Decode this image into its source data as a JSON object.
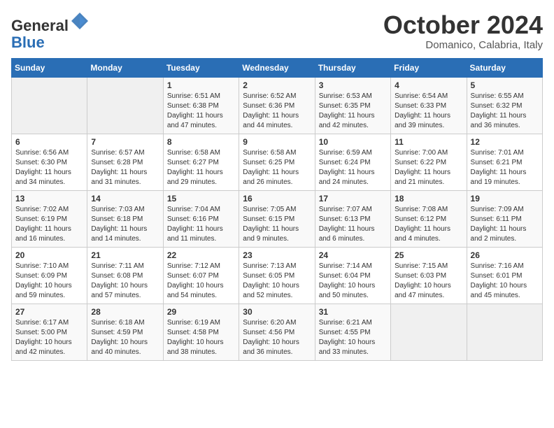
{
  "header": {
    "logo_line1": "General",
    "logo_line2": "Blue",
    "month": "October 2024",
    "location": "Domanico, Calabria, Italy"
  },
  "days_of_week": [
    "Sunday",
    "Monday",
    "Tuesday",
    "Wednesday",
    "Thursday",
    "Friday",
    "Saturday"
  ],
  "weeks": [
    [
      {
        "day": "",
        "info": ""
      },
      {
        "day": "",
        "info": ""
      },
      {
        "day": "1",
        "info": "Sunrise: 6:51 AM\nSunset: 6:38 PM\nDaylight: 11 hours\nand 47 minutes."
      },
      {
        "day": "2",
        "info": "Sunrise: 6:52 AM\nSunset: 6:36 PM\nDaylight: 11 hours\nand 44 minutes."
      },
      {
        "day": "3",
        "info": "Sunrise: 6:53 AM\nSunset: 6:35 PM\nDaylight: 11 hours\nand 42 minutes."
      },
      {
        "day": "4",
        "info": "Sunrise: 6:54 AM\nSunset: 6:33 PM\nDaylight: 11 hours\nand 39 minutes."
      },
      {
        "day": "5",
        "info": "Sunrise: 6:55 AM\nSunset: 6:32 PM\nDaylight: 11 hours\nand 36 minutes."
      }
    ],
    [
      {
        "day": "6",
        "info": "Sunrise: 6:56 AM\nSunset: 6:30 PM\nDaylight: 11 hours\nand 34 minutes."
      },
      {
        "day": "7",
        "info": "Sunrise: 6:57 AM\nSunset: 6:28 PM\nDaylight: 11 hours\nand 31 minutes."
      },
      {
        "day": "8",
        "info": "Sunrise: 6:58 AM\nSunset: 6:27 PM\nDaylight: 11 hours\nand 29 minutes."
      },
      {
        "day": "9",
        "info": "Sunrise: 6:58 AM\nSunset: 6:25 PM\nDaylight: 11 hours\nand 26 minutes."
      },
      {
        "day": "10",
        "info": "Sunrise: 6:59 AM\nSunset: 6:24 PM\nDaylight: 11 hours\nand 24 minutes."
      },
      {
        "day": "11",
        "info": "Sunrise: 7:00 AM\nSunset: 6:22 PM\nDaylight: 11 hours\nand 21 minutes."
      },
      {
        "day": "12",
        "info": "Sunrise: 7:01 AM\nSunset: 6:21 PM\nDaylight: 11 hours\nand 19 minutes."
      }
    ],
    [
      {
        "day": "13",
        "info": "Sunrise: 7:02 AM\nSunset: 6:19 PM\nDaylight: 11 hours\nand 16 minutes."
      },
      {
        "day": "14",
        "info": "Sunrise: 7:03 AM\nSunset: 6:18 PM\nDaylight: 11 hours\nand 14 minutes."
      },
      {
        "day": "15",
        "info": "Sunrise: 7:04 AM\nSunset: 6:16 PM\nDaylight: 11 hours\nand 11 minutes."
      },
      {
        "day": "16",
        "info": "Sunrise: 7:05 AM\nSunset: 6:15 PM\nDaylight: 11 hours\nand 9 minutes."
      },
      {
        "day": "17",
        "info": "Sunrise: 7:07 AM\nSunset: 6:13 PM\nDaylight: 11 hours\nand 6 minutes."
      },
      {
        "day": "18",
        "info": "Sunrise: 7:08 AM\nSunset: 6:12 PM\nDaylight: 11 hours\nand 4 minutes."
      },
      {
        "day": "19",
        "info": "Sunrise: 7:09 AM\nSunset: 6:11 PM\nDaylight: 11 hours\nand 2 minutes."
      }
    ],
    [
      {
        "day": "20",
        "info": "Sunrise: 7:10 AM\nSunset: 6:09 PM\nDaylight: 10 hours\nand 59 minutes."
      },
      {
        "day": "21",
        "info": "Sunrise: 7:11 AM\nSunset: 6:08 PM\nDaylight: 10 hours\nand 57 minutes."
      },
      {
        "day": "22",
        "info": "Sunrise: 7:12 AM\nSunset: 6:07 PM\nDaylight: 10 hours\nand 54 minutes."
      },
      {
        "day": "23",
        "info": "Sunrise: 7:13 AM\nSunset: 6:05 PM\nDaylight: 10 hours\nand 52 minutes."
      },
      {
        "day": "24",
        "info": "Sunrise: 7:14 AM\nSunset: 6:04 PM\nDaylight: 10 hours\nand 50 minutes."
      },
      {
        "day": "25",
        "info": "Sunrise: 7:15 AM\nSunset: 6:03 PM\nDaylight: 10 hours\nand 47 minutes."
      },
      {
        "day": "26",
        "info": "Sunrise: 7:16 AM\nSunset: 6:01 PM\nDaylight: 10 hours\nand 45 minutes."
      }
    ],
    [
      {
        "day": "27",
        "info": "Sunrise: 6:17 AM\nSunset: 5:00 PM\nDaylight: 10 hours\nand 42 minutes."
      },
      {
        "day": "28",
        "info": "Sunrise: 6:18 AM\nSunset: 4:59 PM\nDaylight: 10 hours\nand 40 minutes."
      },
      {
        "day": "29",
        "info": "Sunrise: 6:19 AM\nSunset: 4:58 PM\nDaylight: 10 hours\nand 38 minutes."
      },
      {
        "day": "30",
        "info": "Sunrise: 6:20 AM\nSunset: 4:56 PM\nDaylight: 10 hours\nand 36 minutes."
      },
      {
        "day": "31",
        "info": "Sunrise: 6:21 AM\nSunset: 4:55 PM\nDaylight: 10 hours\nand 33 minutes."
      },
      {
        "day": "",
        "info": ""
      },
      {
        "day": "",
        "info": ""
      }
    ]
  ]
}
